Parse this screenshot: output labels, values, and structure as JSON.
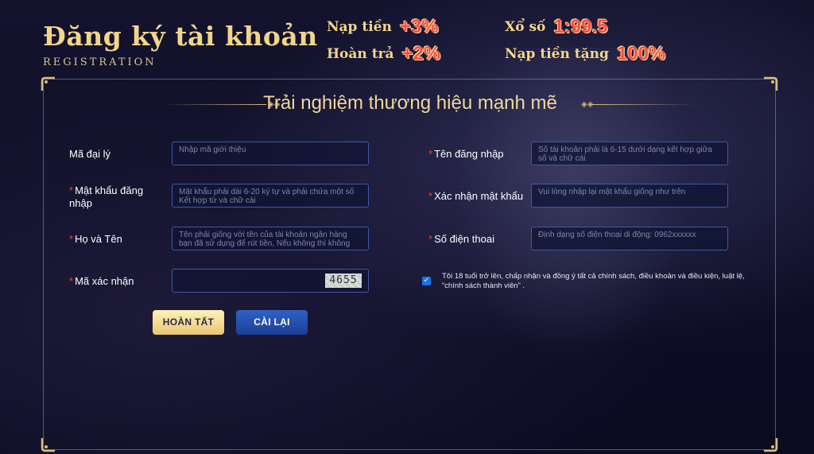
{
  "header": {
    "title": "Đăng ký tài khoản",
    "subtitle": "REGISTRATION",
    "promos": [
      {
        "label": "Nạp tiền",
        "value": "+3%"
      },
      {
        "label": "Hoàn trả",
        "value": "+2%"
      },
      {
        "label": "Xổ số",
        "value": "1:99.5"
      },
      {
        "label": "Nạp tiền tặng",
        "value": "100%"
      }
    ]
  },
  "form": {
    "section_title": "Trải nghiệm thương hiệu mạnh mẽ",
    "required_mark": "*",
    "agent_code": {
      "label": "Mã đại lý",
      "placeholder": "Nhập mã giới thiệu"
    },
    "password": {
      "label": "Mật khẩu đăng nhập",
      "placeholder": "Mật khẩu phải dài 6-20 ký tự và phải chứa một số Kết hợp từ và chữ cái"
    },
    "full_name": {
      "label": "Họ và Tên",
      "placeholder": "Tên phải giống với tên của tài khoản ngân hàng bạn đã sử dụng để rút tiền, Nếu không thì không"
    },
    "captcha": {
      "label": "Mã xác nhận",
      "code": "4655"
    },
    "username": {
      "label": "Tên đăng nhập",
      "placeholder": "Số tài khoản phải là 6-15 dưới dạng kết hợp giữa số và chữ cái"
    },
    "confirm_password": {
      "label": "Xác nhận mật khẩu",
      "placeholder": "Vui lòng nhập lại mật khẩu giống như trên"
    },
    "phone": {
      "label": "Số điện thoai",
      "placeholder": "Định dạng số điện thoại di động: 0962xxxxxx"
    },
    "agreement": {
      "checked": true,
      "text": "Tôi 18 tuổi trở lên, chấp nhận và đồng ý tất cả chính sách, điều khoản và điều kiện, luật lệ, “chính sách thành viên” ."
    },
    "buttons": {
      "submit": "HOÀN TẤT",
      "reset": "CÀI LẠI"
    }
  },
  "colors": {
    "gold": "#f2d58a",
    "accent_red": "#ff4c3b",
    "field_border": "#3d5aa8",
    "reset_blue": "#1d3f94",
    "submit_gold": "#e9c773"
  }
}
